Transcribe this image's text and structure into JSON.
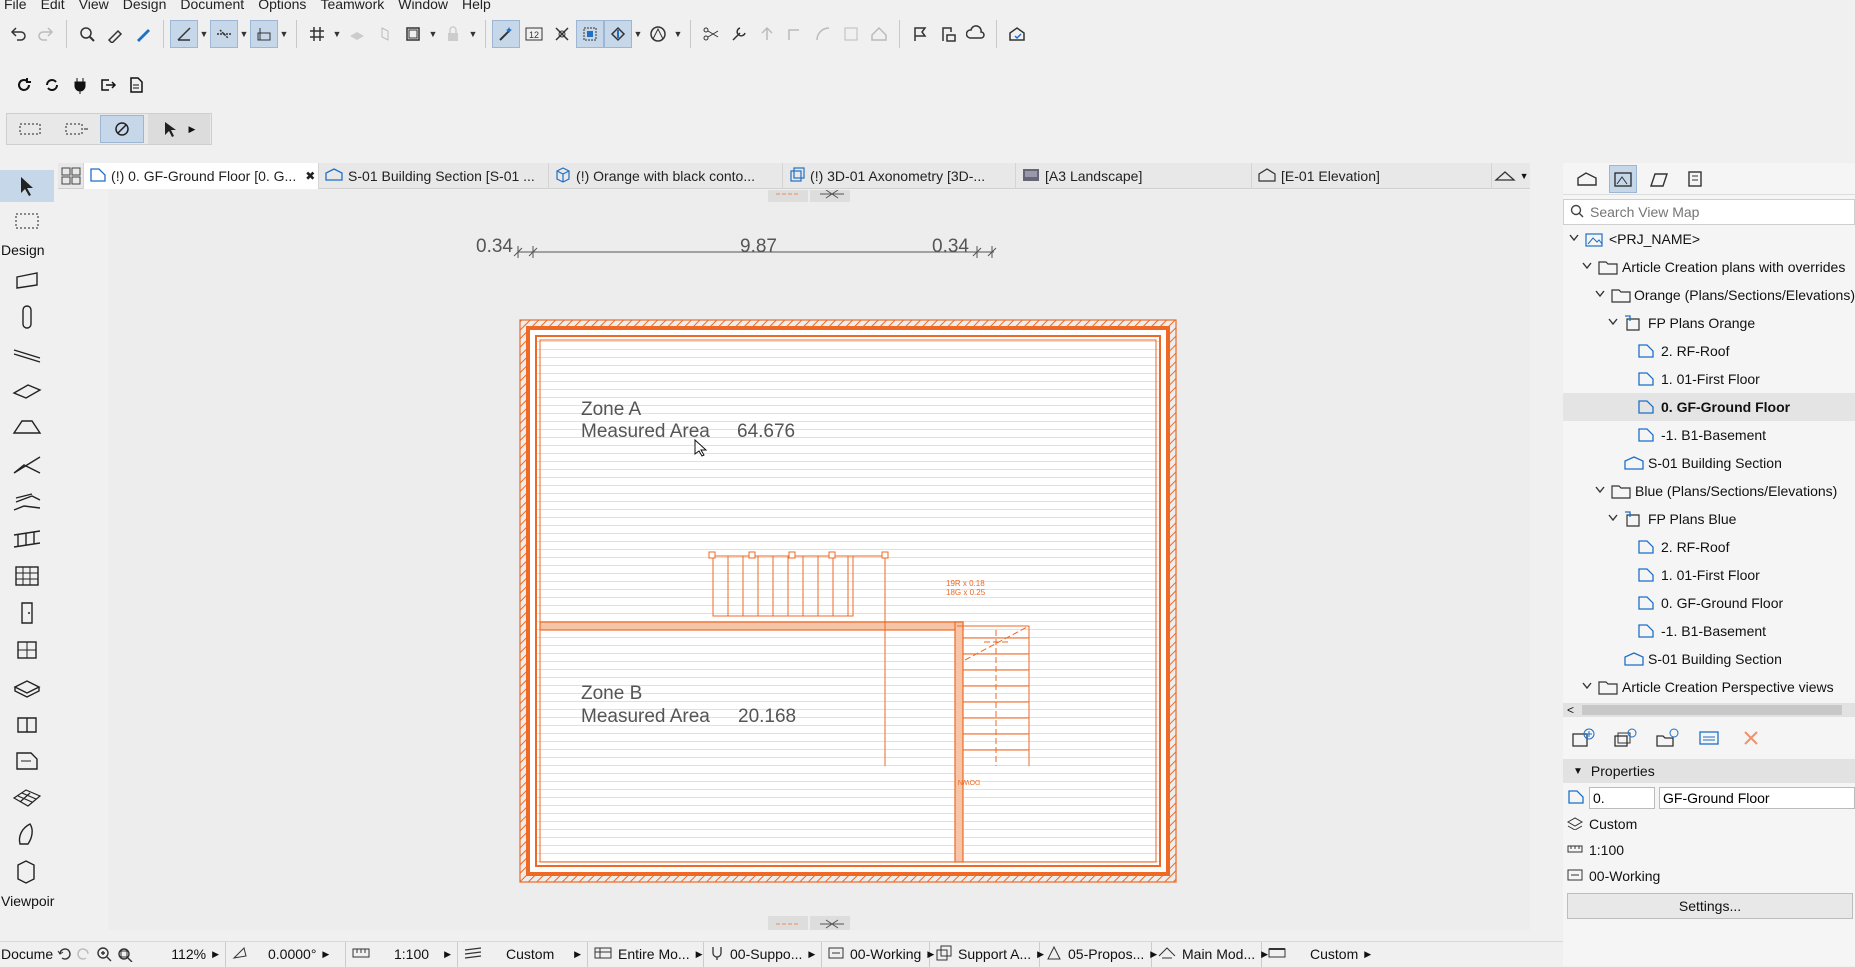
{
  "menu": [
    "File",
    "Edit",
    "View",
    "Design",
    "Document",
    "Options",
    "Teamwork",
    "Window",
    "Help"
  ],
  "toolbox": {
    "design_label": "Design",
    "viewpoint_label": "Viewpoir",
    "document_label": "Docume"
  },
  "tabs": [
    {
      "label": "(!) 0. GF-Ground Floor [0. G...",
      "icon": "floor-plan-icon",
      "active": true
    },
    {
      "label": "S-01 Building Section [S-01 ...",
      "icon": "section-icon"
    },
    {
      "label": "(!) Orange with black conto...",
      "icon": "3d-box-icon"
    },
    {
      "label": "(!) 3D-01 Axonometry [3D-...",
      "icon": "axonometry-icon"
    },
    {
      "label": "[A3 Landscape]",
      "icon": "layout-icon"
    },
    {
      "label": "[E-01 Elevation]",
      "icon": "elevation-icon"
    }
  ],
  "dimensions": {
    "left": "0.34",
    "middle": "9.87",
    "right": "0.34"
  },
  "zones": [
    {
      "name": "Zone A",
      "label": "Measured Area",
      "value": "64.676"
    },
    {
      "name": "Zone B",
      "label": "Measured Area",
      "value": "20.168"
    }
  ],
  "stair": {
    "annotation1": "19R x 0.18",
    "annotation2": "18G x 0.25",
    "down": "DOWN"
  },
  "navigator": {
    "search_placeholder": "Search View Map",
    "items": [
      {
        "label": "<PRJ_NAME>",
        "indent": 0,
        "icon": "project-icon",
        "arrow": "v"
      },
      {
        "label": "Article Creation plans with overrides",
        "indent": 1,
        "icon": "folder-icon",
        "arrow": "v"
      },
      {
        "label": "Orange (Plans/Sections/Elevations)",
        "indent": 2,
        "icon": "folder-icon",
        "arrow": "v"
      },
      {
        "label": "FP Plans Orange",
        "indent": 3,
        "icon": "plans-folder-icon",
        "arrow": "v"
      },
      {
        "label": "2. RF-Roof",
        "indent": 4,
        "icon": "floor-plan-icon",
        "arrow": ""
      },
      {
        "label": "1. 01-First Floor",
        "indent": 4,
        "icon": "floor-plan-icon",
        "arrow": ""
      },
      {
        "label": "0. GF-Ground Floor",
        "indent": 4,
        "icon": "floor-plan-icon",
        "arrow": "",
        "selected": true
      },
      {
        "label": "-1. B1-Basement",
        "indent": 4,
        "icon": "floor-plan-icon",
        "arrow": ""
      },
      {
        "label": "S-01 Building Section",
        "indent": 3,
        "icon": "section-icon",
        "arrow": ""
      },
      {
        "label": "Blue (Plans/Sections/Elevations)",
        "indent": 2,
        "icon": "folder-icon",
        "arrow": "v"
      },
      {
        "label": "FP Plans Blue",
        "indent": 3,
        "icon": "plans-folder-icon",
        "arrow": "v"
      },
      {
        "label": "2. RF-Roof",
        "indent": 4,
        "icon": "floor-plan-icon",
        "arrow": ""
      },
      {
        "label": "1. 01-First Floor",
        "indent": 4,
        "icon": "floor-plan-icon",
        "arrow": ""
      },
      {
        "label": "0. GF-Ground Floor",
        "indent": 4,
        "icon": "floor-plan-icon",
        "arrow": ""
      },
      {
        "label": "-1. B1-Basement",
        "indent": 4,
        "icon": "floor-plan-icon",
        "arrow": ""
      },
      {
        "label": "S-01 Building Section",
        "indent": 3,
        "icon": "section-icon",
        "arrow": ""
      },
      {
        "label": "Article Creation Perspective views",
        "indent": 1,
        "icon": "folder-icon",
        "arrow": "v"
      }
    ]
  },
  "properties": {
    "header": "Properties",
    "story_number": "0.",
    "story_name": "GF-Ground Floor",
    "view_set": "Custom",
    "scale": "1:100",
    "layer_combo": "00-Working",
    "settings_button": "Settings..."
  },
  "status": {
    "zoom": "112%",
    "angle": "0.0000°",
    "scale": "1:100",
    "pen_set": "Custom",
    "model_view": "Entire Mo...",
    "graphic_override": "00-Suppo...",
    "layer": "00-Working",
    "renovation": "Support A...",
    "renovation_filter": "05-Propos...",
    "structure": "Main Mod...",
    "dimension": "Custom"
  },
  "colors": {
    "accent": "#ee6a24",
    "selection": "#c7d7ea",
    "icon_blue": "#1f6fc5"
  }
}
